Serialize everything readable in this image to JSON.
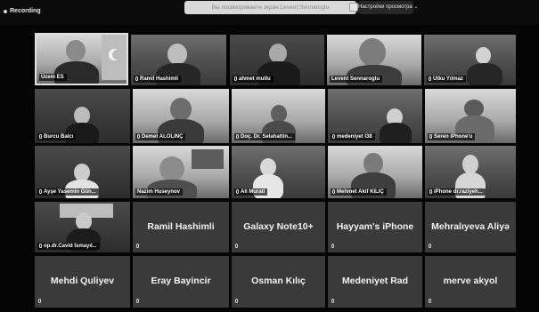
{
  "recording": {
    "label": "Recording"
  },
  "share_banner": {
    "text": "Вы посматриваете экран Levent Sennaroglu"
  },
  "view_options": {
    "label": "Настройки просмотра ⌄"
  },
  "participants": [
    {
      "name": "Uzem ES",
      "has_video": true,
      "active": true
    },
    {
      "name": "Ramil Hashimli",
      "has_video": true
    },
    {
      "name": "ahmet mutlu",
      "has_video": true
    },
    {
      "name": "Levent Sennaroglu",
      "has_video": true
    },
    {
      "name": "Utku Yılmaz",
      "has_video": true
    },
    {
      "name": "Burcu Balcı",
      "has_video": true
    },
    {
      "name": "Demet ALOLINÇ",
      "has_video": true
    },
    {
      "name": "Doç. Dr. Selahattin...",
      "has_video": true
    },
    {
      "name": "medeniyet İ38",
      "has_video": true
    },
    {
      "name": "Seren iPhone'u",
      "has_video": true
    },
    {
      "name": "Ayşe Yasemin Gün...",
      "has_video": true
    },
    {
      "name": "Nazim Huseynov",
      "has_video": true
    },
    {
      "name": "Ali Murati",
      "has_video": true
    },
    {
      "name": "Mehmet Akif KILIÇ",
      "has_video": true
    },
    {
      "name": "iPhone dr.raziyeh...",
      "has_video": true
    },
    {
      "name": "op.dr.Cavid İsmayıl...",
      "has_video": true
    },
    {
      "name": "Ramil Hashimli",
      "has_video": false
    },
    {
      "name": "Galaxy Note10+",
      "has_video": false
    },
    {
      "name": "Hayyam's iPhone",
      "has_video": false
    },
    {
      "name": "Mehralıyeva Aliyə",
      "has_video": false
    },
    {
      "name": "Mehdi Quliyev",
      "has_video": false
    },
    {
      "name": "Eray Bayincir",
      "has_video": false
    },
    {
      "name": "Osman Kılıç",
      "has_video": false
    },
    {
      "name": "Medeniyet Rad",
      "has_video": false
    },
    {
      "name": "merve akyol",
      "has_video": false
    }
  ]
}
